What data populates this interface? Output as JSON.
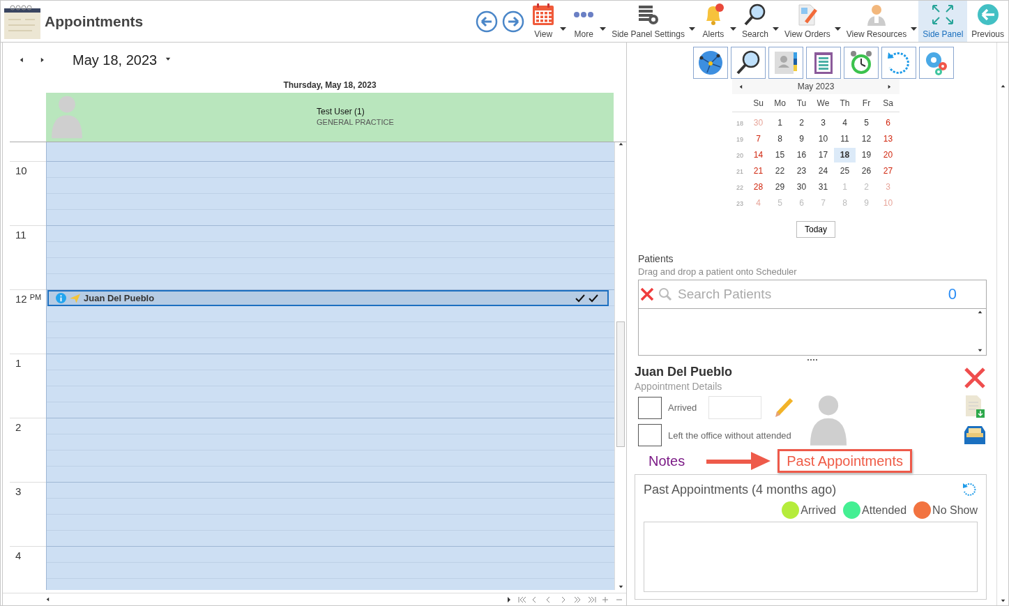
{
  "header": {
    "title": "Appointments",
    "toolbar": [
      {
        "label": "View",
        "kind": "calendar",
        "dropdown": true,
        "selected": false
      },
      {
        "label": "More",
        "kind": "dots",
        "dropdown": true,
        "selected": false
      },
      {
        "label": "Side Panel Settings",
        "kind": "settings-list",
        "dropdown": true,
        "selected": false
      },
      {
        "label": "Alerts",
        "kind": "bell",
        "dropdown": true,
        "selected": false
      },
      {
        "label": "Search",
        "kind": "magnifier",
        "dropdown": true,
        "selected": false
      },
      {
        "label": "View Orders",
        "kind": "document",
        "dropdown": true,
        "selected": false
      },
      {
        "label": "View Resources",
        "kind": "doctor",
        "dropdown": true,
        "selected": false
      },
      {
        "label": "Side Panel",
        "kind": "expand",
        "dropdown": false,
        "selected": true
      },
      {
        "label": "Previous",
        "kind": "back",
        "dropdown": false,
        "selected": false
      }
    ]
  },
  "scheduler": {
    "date": "May 18, 2023",
    "day_header": "Thursday, May 18, 2023",
    "resource": {
      "name": "Test User (1)",
      "specialty": "GENERAL PRACTICE"
    },
    "hours": [
      {
        "label": "10"
      },
      {
        "label": "11"
      },
      {
        "label": "12",
        "suffix": "PM",
        "appointment": {
          "patient": "Juan Del Pueblo",
          "selected": true
        }
      },
      {
        "label": "1"
      },
      {
        "label": "2"
      },
      {
        "label": "3"
      },
      {
        "label": "4"
      }
    ]
  },
  "side_panel": {
    "tools": [
      {
        "kind": "globe"
      },
      {
        "kind": "magnifier"
      },
      {
        "kind": "contacts"
      },
      {
        "kind": "clipboard"
      },
      {
        "kind": "alarm"
      },
      {
        "kind": "refresh"
      },
      {
        "kind": "gears"
      }
    ],
    "calendar": {
      "month": "May 2023",
      "weekdays": [
        "Su",
        "Mo",
        "Tu",
        "We",
        "Th",
        "Fr",
        "Sa"
      ],
      "weeks": [
        {
          "number": "18",
          "days": [
            {
              "d": "30",
              "muted": true,
              "selected": false
            },
            {
              "d": "1",
              "muted": false,
              "selected": false
            },
            {
              "d": "2",
              "muted": false,
              "selected": false
            },
            {
              "d": "3",
              "muted": false,
              "selected": false
            },
            {
              "d": "4",
              "muted": false,
              "selected": false
            },
            {
              "d": "5",
              "muted": false,
              "selected": false
            },
            {
              "d": "6",
              "muted": false,
              "selected": false
            }
          ]
        },
        {
          "number": "19",
          "days": [
            {
              "d": "7",
              "muted": false,
              "selected": false
            },
            {
              "d": "8",
              "muted": false,
              "selected": false
            },
            {
              "d": "9",
              "muted": false,
              "selected": false
            },
            {
              "d": "10",
              "muted": false,
              "selected": false
            },
            {
              "d": "11",
              "muted": false,
              "selected": false
            },
            {
              "d": "12",
              "muted": false,
              "selected": false
            },
            {
              "d": "13",
              "muted": false,
              "selected": false
            }
          ]
        },
        {
          "number": "20",
          "days": [
            {
              "d": "14",
              "muted": false,
              "selected": false
            },
            {
              "d": "15",
              "muted": false,
              "selected": false
            },
            {
              "d": "16",
              "muted": false,
              "selected": false
            },
            {
              "d": "17",
              "muted": false,
              "selected": false
            },
            {
              "d": "18",
              "muted": false,
              "selected": true
            },
            {
              "d": "19",
              "muted": false,
              "selected": false
            },
            {
              "d": "20",
              "muted": false,
              "selected": false
            }
          ]
        },
        {
          "number": "21",
          "days": [
            {
              "d": "21",
              "muted": false,
              "selected": false
            },
            {
              "d": "22",
              "muted": false,
              "selected": false
            },
            {
              "d": "23",
              "muted": false,
              "selected": false
            },
            {
              "d": "24",
              "muted": false,
              "selected": false
            },
            {
              "d": "25",
              "muted": false,
              "selected": false
            },
            {
              "d": "26",
              "muted": false,
              "selected": false
            },
            {
              "d": "27",
              "muted": false,
              "selected": false
            }
          ]
        },
        {
          "number": "22",
          "days": [
            {
              "d": "28",
              "muted": false,
              "selected": false
            },
            {
              "d": "29",
              "muted": false,
              "selected": false
            },
            {
              "d": "30",
              "muted": false,
              "selected": false
            },
            {
              "d": "31",
              "muted": false,
              "selected": false
            },
            {
              "d": "1",
              "muted": true,
              "selected": false
            },
            {
              "d": "2",
              "muted": true,
              "selected": false
            },
            {
              "d": "3",
              "muted": true,
              "selected": false
            }
          ]
        },
        {
          "number": "23",
          "days": [
            {
              "d": "4",
              "muted": true,
              "selected": false
            },
            {
              "d": "5",
              "muted": true,
              "selected": false
            },
            {
              "d": "6",
              "muted": true,
              "selected": false
            },
            {
              "d": "7",
              "muted": true,
              "selected": false
            },
            {
              "d": "8",
              "muted": true,
              "selected": false
            },
            {
              "d": "9",
              "muted": true,
              "selected": false
            },
            {
              "d": "10",
              "muted": true,
              "selected": false
            }
          ]
        }
      ],
      "today_button": "Today"
    },
    "patients": {
      "title": "Patients",
      "hint": "Drag and drop a patient onto Scheduler",
      "search_placeholder": "Search Patients",
      "count": "0"
    },
    "details": {
      "patient": "Juan Del Pueblo",
      "subtitle": "Appointment Details",
      "checks": [
        {
          "label": "Arrived",
          "checked": false,
          "kind": "with-field"
        },
        {
          "label": "Left the office without attended",
          "checked": false,
          "kind": "plain"
        }
      ]
    },
    "tabs": [
      {
        "label": "Notes",
        "selected": false
      },
      {
        "label": "Past Appointments",
        "selected": true
      }
    ],
    "past": {
      "title": "Past Appointments (4 months ago)",
      "legend": [
        {
          "label": "Arrived",
          "color": "#b5ec3b"
        },
        {
          "label": "Attended",
          "color": "#44ef93"
        },
        {
          "label": "No Show",
          "color": "#f27340"
        }
      ]
    }
  }
}
